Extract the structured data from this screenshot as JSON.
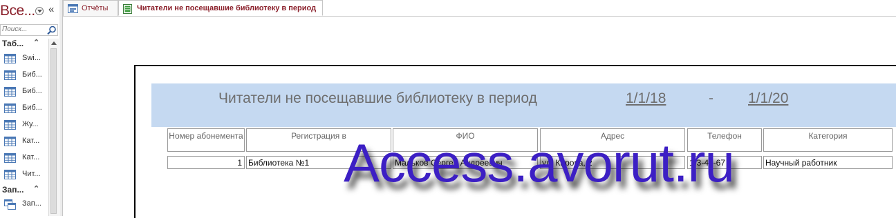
{
  "nav": {
    "title": "Все...",
    "search_placeholder": "Поиск...",
    "groups": [
      {
        "label": "Таб...",
        "chevron": "«",
        "items": [
          {
            "label": "Swi...",
            "icon": "table-icon"
          },
          {
            "label": "Биб...",
            "icon": "table-icon"
          },
          {
            "label": "Биб...",
            "icon": "table-icon"
          },
          {
            "label": "Биб...",
            "icon": "table-icon"
          },
          {
            "label": "Жу...",
            "icon": "table-icon"
          },
          {
            "label": "Кат...",
            "icon": "table-icon"
          },
          {
            "label": "Кат...",
            "icon": "table-icon"
          },
          {
            "label": "Чит...",
            "icon": "table-icon"
          }
        ]
      },
      {
        "label": "Зап...",
        "chevron": "«",
        "items": [
          {
            "label": "Зап...",
            "icon": "query-icon"
          }
        ]
      }
    ]
  },
  "tabs": [
    {
      "label": "Отчёты",
      "icon": "form-icon",
      "active": false
    },
    {
      "label": "Читатели не посещавшие библиотеку в период",
      "icon": "report-icon",
      "active": true
    }
  ],
  "report": {
    "title": "Читатели не посещавшие библиотеку в период",
    "date_from": "1/1/18",
    "separator": "-",
    "date_to": "1/1/20",
    "header_color": "#c5d9f1",
    "columns": [
      "Номер абонемента",
      "Регистрация в",
      "ФИО",
      "Адрес",
      "Телефон",
      "Категория"
    ],
    "rows": [
      [
        "1",
        "Библиотека №1",
        "Мальков Сергей Андреевич",
        "ул. Кирова, 2",
        "1-3-45-67",
        "Научный работник"
      ]
    ]
  },
  "watermark": "Access.avorut.ru",
  "colors": {
    "accent": "#8a1f2a",
    "watermark": "#3c1fc4"
  }
}
